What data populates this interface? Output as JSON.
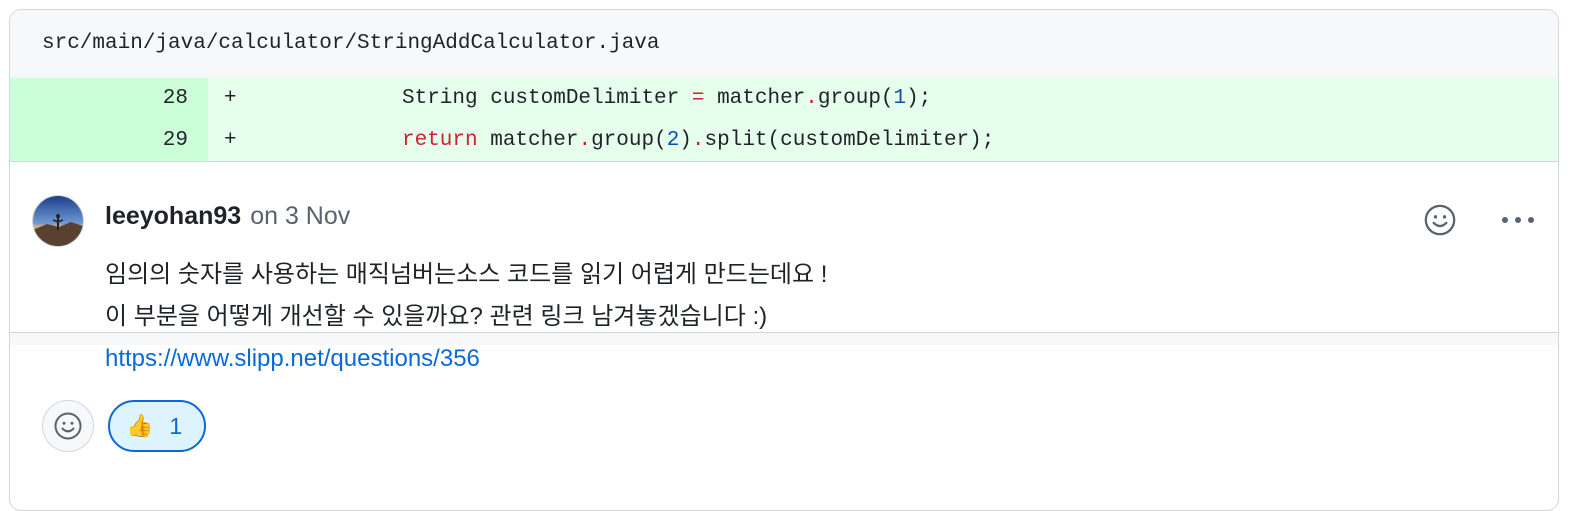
{
  "file": {
    "path": "src/main/java/calculator/StringAddCalculator.java"
  },
  "diff": {
    "lines": [
      {
        "number": "28",
        "marker": "+"
      },
      {
        "number": "29",
        "marker": "+"
      }
    ],
    "line1": {
      "t1": "String customDelimiter ",
      "op1": "=",
      "t2": " matcher",
      "op2": ".",
      "t3": "group(",
      "num": "1",
      "t4": ");"
    },
    "line2": {
      "kw": "return",
      "t1": " matcher",
      "op1": ".",
      "t2": "group(",
      "num": "2",
      "t3": ")",
      "op2": ".",
      "t4": "split(customDelimiter);"
    }
  },
  "comment": {
    "author": "leeyohan93",
    "date": "on 3 Nov",
    "body_line1": "임의의 숫자를 사용하는 매직넘버는소스 코드를 읽기 어렵게 만드는데요 !",
    "body_line2": "이 부분을 어떻게 개선할 수 있을까요? 관련 링크 남겨놓겠습니다 :)",
    "link": "https://www.slipp.net/questions/356",
    "icons": {
      "emoji": "smiley-icon",
      "more": "kebab-horizontal-icon"
    }
  },
  "reactions": [
    {
      "emoji": "👍",
      "count": "1"
    }
  ],
  "colors": {
    "diff_added_bg": "#e6ffec",
    "diff_added_num_bg": "#ccffd8",
    "link": "#0969da",
    "keyword": "#cf222e",
    "number": "#0550ae"
  }
}
